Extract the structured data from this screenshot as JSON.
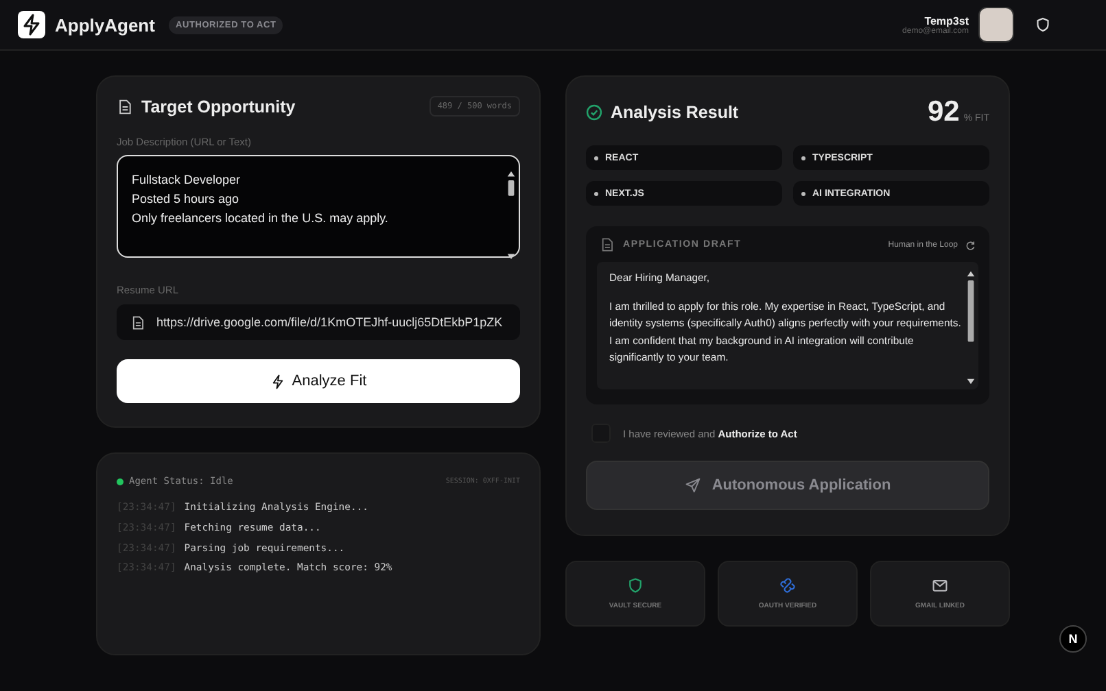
{
  "header": {
    "logo_text": "ApplyAgent",
    "badge": "AUTHORIZED TO ACT",
    "user": {
      "name": "Temp3st",
      "email": "demo@email.com"
    }
  },
  "opportunity": {
    "title": "Target Opportunity",
    "word_count": "489 / 500 words",
    "job_label": "Job Description (URL or Text)",
    "job_lines": [
      "Fullstack Developer",
      "Posted 5 hours ago",
      "Only freelancers located in the U.S. may apply."
    ],
    "resume_label": "Resume URL",
    "resume_url": "https://drive.google.com/file/d/1KmOTEJhf-uuclj65DtEkbP1pZK",
    "analyze_button": "Analyze Fit"
  },
  "console": {
    "status": "Agent Status: Idle",
    "session": "SESSION: 0XFF-INIT",
    "logs": [
      {
        "time": "[23:34:47]",
        "message": "Initializing Analysis Engine..."
      },
      {
        "time": "[23:34:47]",
        "message": "Fetching resume data..."
      },
      {
        "time": "[23:34:47]",
        "message": "Parsing job requirements..."
      },
      {
        "time": "[23:34:47]",
        "message": "Analysis complete. Match score: 92%"
      }
    ]
  },
  "result": {
    "title": "Analysis Result",
    "score": "92",
    "score_unit": "% FIT",
    "skills": [
      "REACT",
      "TYPESCRIPT",
      "NEXT.JS",
      "AI INTEGRATION"
    ],
    "draft": {
      "title": "APPLICATION DRAFT",
      "mode": "Human in the Loop",
      "paragraphs": [
        "Dear Hiring Manager,",
        "I am thrilled to apply for this role. My expertise in React, TypeScript, and identity systems (specifically Auth0) aligns perfectly with your requirements. I am confident that my background in AI integration will contribute significantly to your team."
      ]
    },
    "authorize": {
      "checked": false,
      "text": "I have reviewed and **Authorize to Act**"
    },
    "submit": {
      "label": "Autonomous Application",
      "disabled": true
    }
  },
  "badges": [
    {
      "label": "VAULT SECURE",
      "kind": "shield"
    },
    {
      "label": "OAUTH VERIFIED",
      "kind": "link"
    },
    {
      "label": "GMAIL LINKED",
      "kind": "mail"
    }
  ],
  "dev_indicator": "N"
}
